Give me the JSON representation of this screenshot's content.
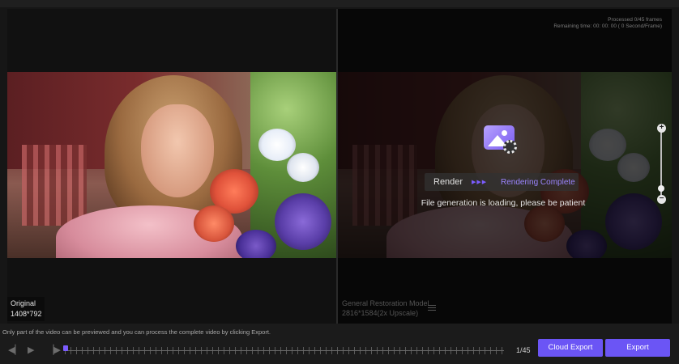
{
  "left_pane": {
    "label_title": "Original",
    "label_resolution": "1408*792"
  },
  "right_pane": {
    "processed": "Processed 0/45 frames",
    "remaining": "Remaining time: 00: 00: 00 ( 0 Second/Frame)",
    "model_name": "General Restoration Model",
    "model_resolution": "2816*1584(2x Upscale)"
  },
  "overlay": {
    "render_label": "Render",
    "status": "Rendering Complete",
    "message": "File generation is loading, please be patient"
  },
  "zoom": {
    "plus": "+",
    "minus": "−",
    "level": 0.15
  },
  "footer": {
    "notice": "Only part of the video can be previewed and you can process the complete video by clicking Export.",
    "frame_counter": "1/45",
    "cloud_export_label": "Cloud Export",
    "export_label": "Export"
  },
  "colors": {
    "accent": "#6b55f5",
    "status_text": "#9b85ff"
  }
}
